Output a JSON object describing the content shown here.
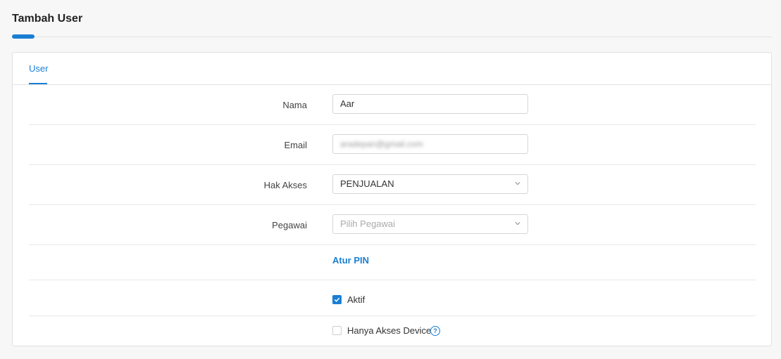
{
  "page": {
    "title": "Tambah User"
  },
  "tabs": [
    {
      "label": "User"
    }
  ],
  "form": {
    "nama": {
      "label": "Nama",
      "value": "Aar"
    },
    "email": {
      "label": "Email",
      "value": "aradepan@gmail.com"
    },
    "hak_akses": {
      "label": "Hak Akses",
      "value": "PENJUALAN"
    },
    "pegawai": {
      "label": "Pegawai",
      "placeholder": "Pilih Pegawai"
    },
    "atur_pin": {
      "label": "Atur PIN"
    },
    "aktif": {
      "label": "Aktif",
      "checked": true
    },
    "hanya_akses_device": {
      "label": "Hanya Akses Device",
      "checked": false
    }
  },
  "icons": {
    "dropdown": "chevron-down-icon",
    "check": "checkmark-icon",
    "help": "question-circle-icon"
  },
  "colors": {
    "accent": "#1a7fd4"
  }
}
